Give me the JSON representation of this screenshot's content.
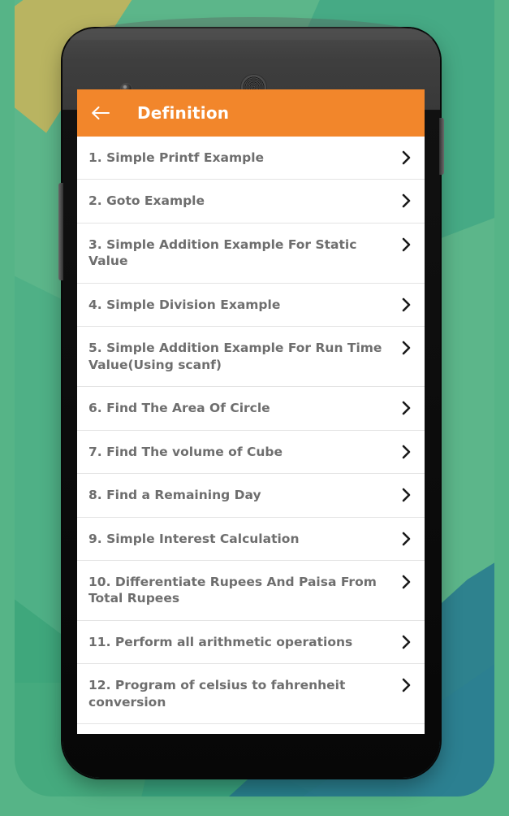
{
  "colors": {
    "appbar": "#F2862B",
    "appbar_text": "#FFFFFF",
    "list_text": "#6E6E6E",
    "list_bg": "#FFFFFF",
    "divider": "#E3E3E3",
    "chevron": "#1A1A1A",
    "background_green": "#56B487",
    "background_olive": "#B9B461",
    "background_blue": "#24768F",
    "phone_body": "#111111"
  },
  "appbar": {
    "back_icon": "arrow-left-icon",
    "title": "Definition"
  },
  "device": {
    "camera_icon": "front-camera-icon",
    "speaker_icon": "earpiece-speaker-icon",
    "volume_button": "volume-rocker-button",
    "power_button": "power-button"
  },
  "list": {
    "chevron_icon": "chevron-right-icon",
    "items": [
      {
        "label": "1. Simple Printf Example"
      },
      {
        "label": "2. Goto Example"
      },
      {
        "label": "3. Simple Addition Example For Static Value"
      },
      {
        "label": "4. Simple Division Example"
      },
      {
        "label": "5. Simple Addition Example For Run Time Value(Using scanf)"
      },
      {
        "label": "6. Find The Area Of Circle"
      },
      {
        "label": "7. Find The volume of Cube"
      },
      {
        "label": "8. Find a Remaining Day"
      },
      {
        "label": "9. Simple Interest Calculation"
      },
      {
        "label": "10. Differentiate Rupees And Paisa From Total Rupees"
      },
      {
        "label": "11. Perform all arithmetic operations"
      },
      {
        "label": "12. Program of celsius to fahrenheit conversion"
      }
    ]
  }
}
